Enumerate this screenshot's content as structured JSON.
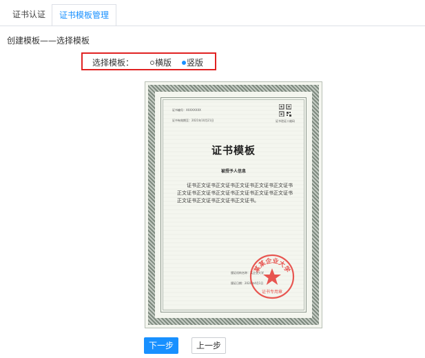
{
  "tabs": [
    {
      "label": "证书认证"
    },
    {
      "label": "证书模板管理"
    }
  ],
  "page": {
    "title": "创建模板——选择模板"
  },
  "template_select": {
    "label": "选择模板：",
    "options": [
      "横版",
      "竖版"
    ],
    "selected": "竖版"
  },
  "certificate": {
    "number_line": "证书编号：XXXXXXXX",
    "validity_line": "证书有效期至：2021年10月21日",
    "qr_caption": "证书验证二维码",
    "title": "证书模板",
    "recipient_heading": "被授予人信息",
    "body": "证书正文证书正文证书正文证书正文证书正文证书正文证书正文证书正文证书正文证书正文证书正文证书正文证书正文证书正文证书正文证书。",
    "issuer_line": "颁证机构名称：某企业大学",
    "issue_date_line": "颁证日期：2020年4月1日",
    "seal_text": "某某企业大学",
    "seal_sub": "证书专用章",
    "colors": {
      "seal": "#e53935",
      "frame": "#8e9a8f"
    }
  },
  "buttons": {
    "next": "下一步",
    "prev": "上一步"
  },
  "colors": {
    "accent": "#1890ff",
    "highlight_border": "#e02020"
  }
}
